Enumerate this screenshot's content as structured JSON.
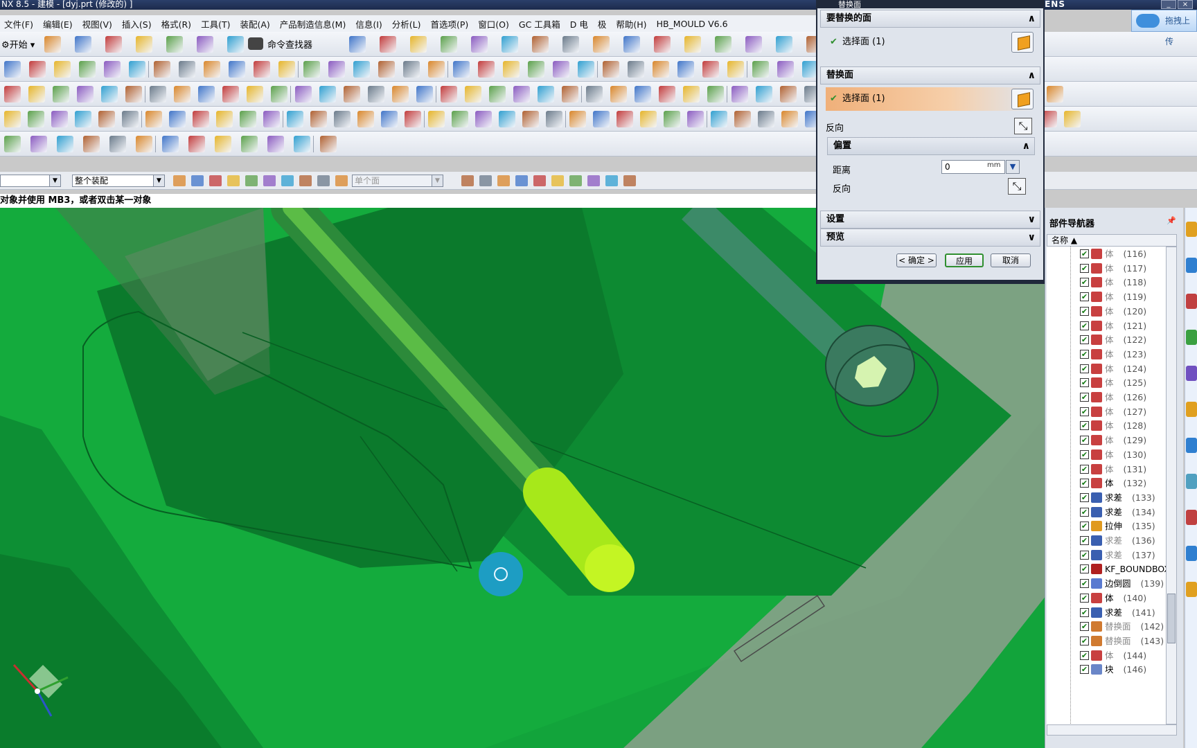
{
  "window": {
    "title": "NX 8.5 - 建模 - [dyj.prt  (修改的) ]",
    "brand": "SIEMENS",
    "cloud_button": "拖拽上传",
    "min_label": "_",
    "close_label": "×"
  },
  "menu": [
    "文件(F)",
    "编辑(E)",
    "视图(V)",
    "插入(S)",
    "格式(R)",
    "工具(T)",
    "装配(A)",
    "产品制造信息(M)",
    "信息(I)",
    "分析(L)",
    "首选项(P)",
    "窗口(O)",
    "GC 工具箱",
    "D 电",
    "极",
    "帮助(H)",
    "HB_MOULD V6.6"
  ],
  "toolbar": {
    "start_label": "开始",
    "command_finder_label": "命令查找器"
  },
  "filter": {
    "type_filter": "",
    "scope": "整个装配",
    "face_rule": "单个面"
  },
  "cue_line": "对象并使用 MB3，或者双击某一对象",
  "dialog": {
    "title": "替换面",
    "section_target": "要替换的面",
    "target_select": "选择面 (1)",
    "section_replace": "替换面",
    "replace_select": "选择面 (1)",
    "reverse": "反向",
    "section_offset": "偏置",
    "distance_label": "距离",
    "distance_value": "0",
    "distance_unit": "mm",
    "offset_reverse": "反向",
    "section_settings": "设置",
    "section_preview": "预览",
    "ok": "< 确定 >",
    "apply": "应用",
    "cancel": "取消"
  },
  "navigator": {
    "title": "部件导航器",
    "column": "名称",
    "items": [
      {
        "label": "体",
        "num": "(116)",
        "icon": "body",
        "dim": true
      },
      {
        "label": "体",
        "num": "(117)",
        "icon": "body",
        "dim": true
      },
      {
        "label": "体",
        "num": "(118)",
        "icon": "body",
        "dim": true
      },
      {
        "label": "体",
        "num": "(119)",
        "icon": "body",
        "dim": true
      },
      {
        "label": "体",
        "num": "(120)",
        "icon": "body",
        "dim": true
      },
      {
        "label": "体",
        "num": "(121)",
        "icon": "body",
        "dim": true
      },
      {
        "label": "体",
        "num": "(122)",
        "icon": "body",
        "dim": true
      },
      {
        "label": "体",
        "num": "(123)",
        "icon": "body",
        "dim": true
      },
      {
        "label": "体",
        "num": "(124)",
        "icon": "body",
        "dim": true
      },
      {
        "label": "体",
        "num": "(125)",
        "icon": "body",
        "dim": true
      },
      {
        "label": "体",
        "num": "(126)",
        "icon": "body",
        "dim": true
      },
      {
        "label": "体",
        "num": "(127)",
        "icon": "body",
        "dim": true
      },
      {
        "label": "体",
        "num": "(128)",
        "icon": "body",
        "dim": true
      },
      {
        "label": "体",
        "num": "(129)",
        "icon": "body",
        "dim": true
      },
      {
        "label": "体",
        "num": "(130)",
        "icon": "body",
        "dim": true
      },
      {
        "label": "体",
        "num": "(131)",
        "icon": "body",
        "dim": true
      },
      {
        "label": "体",
        "num": "(132)",
        "icon": "body",
        "dim": false
      },
      {
        "label": "求差",
        "num": "(133)",
        "icon": "subtract",
        "dim": false
      },
      {
        "label": "求差",
        "num": "(134)",
        "icon": "subtract",
        "dim": false
      },
      {
        "label": "拉伸",
        "num": "(135)",
        "icon": "extrude",
        "dim": false
      },
      {
        "label": "求差",
        "num": "(136)",
        "icon": "subtract",
        "dim": true
      },
      {
        "label": "求差",
        "num": "(137)",
        "icon": "subtract",
        "dim": true
      },
      {
        "label": "KF_BOUNDBOX",
        "num": "",
        "icon": "kf",
        "dim": false
      },
      {
        "label": "边倒圆",
        "num": "(139)",
        "icon": "blend",
        "dim": false
      },
      {
        "label": "体",
        "num": "(140)",
        "icon": "body",
        "dim": false
      },
      {
        "label": "求差",
        "num": "(141)",
        "icon": "subtract",
        "dim": false
      },
      {
        "label": "替换面",
        "num": "(142)",
        "icon": "replace",
        "dim": true
      },
      {
        "label": "替换面",
        "num": "(143)",
        "icon": "replace",
        "dim": true
      },
      {
        "label": "体",
        "num": "(144)",
        "icon": "body",
        "dim": true
      },
      {
        "label": "块",
        "num": "(146)",
        "icon": "block",
        "dim": false
      }
    ]
  },
  "colors": {
    "model_green": "#12a43b",
    "dark_green": "#0a6a26",
    "pin_yellow": "#b9f31a",
    "dialog_highlight": "#f0b07a"
  }
}
